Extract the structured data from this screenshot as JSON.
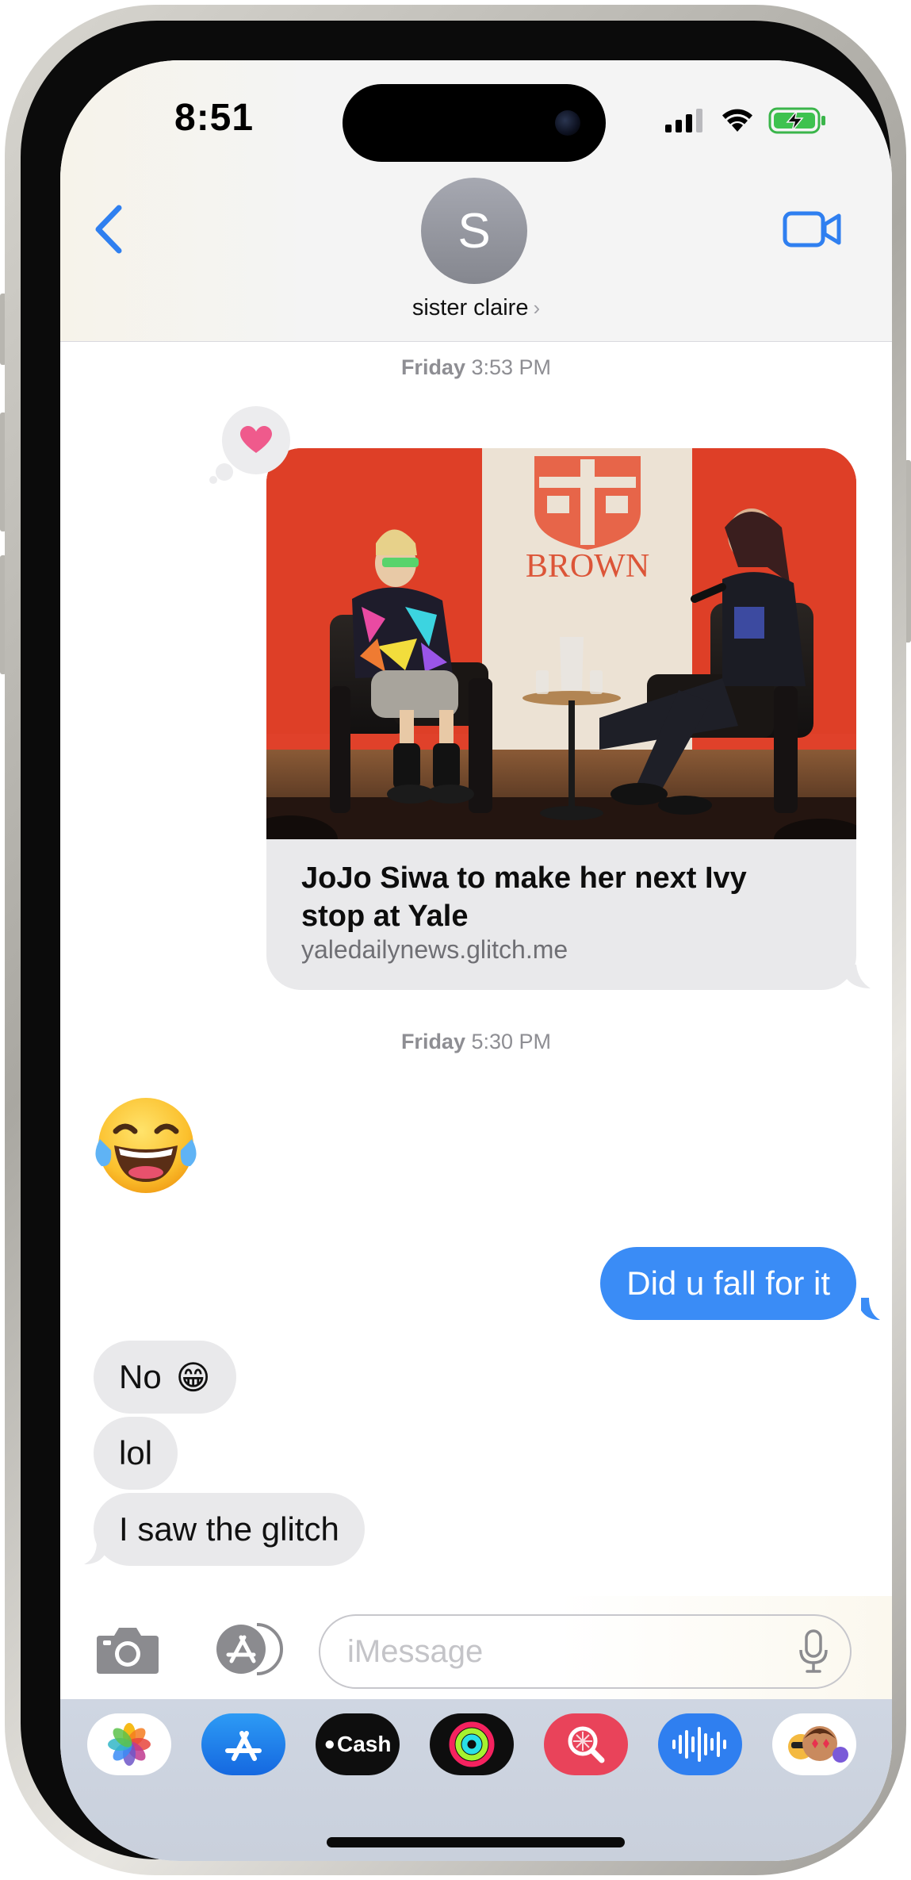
{
  "status_bar": {
    "time": "8:51",
    "icons": [
      "cellular-signal-icon",
      "wifi-icon",
      "battery-charging-icon"
    ]
  },
  "header": {
    "avatar_initial": "S",
    "contact_name": "sister claire",
    "chevron": "›",
    "back_icon": "back-chevron-icon",
    "video_icon": "video-camera-icon"
  },
  "conversation": {
    "timestamps": [
      {
        "day": "Friday",
        "time": "3:53 PM"
      },
      {
        "day": "Friday",
        "time": "5:30 PM"
      }
    ],
    "link_preview": {
      "banner_text": "BROWN",
      "title": "JoJo Siwa to make her next Ivy stop at Yale",
      "url": "yaledailynews.glitch.me",
      "tapback": "heart-icon",
      "colors": {
        "backdrop": "#e0412a",
        "banner": "#ece2d4",
        "tapback_heart": "#ef5a8c"
      }
    },
    "received_emoji": "😂",
    "outgoing": [
      {
        "text": "Did u fall for it"
      }
    ],
    "incoming": [
      {
        "text": "No",
        "emoji": "😁"
      },
      {
        "text": "lol"
      },
      {
        "text": "I saw the glitch"
      }
    ]
  },
  "compose": {
    "placeholder": "iMessage",
    "value": "",
    "camera_icon": "camera-icon",
    "apps_icon": "app-store-icon",
    "mic_icon": "microphone-icon"
  },
  "app_drawer": {
    "apps": [
      {
        "name": "photos-icon"
      },
      {
        "name": "app-store-icon"
      },
      {
        "name": "apple-cash-icon",
        "label": "Cash"
      },
      {
        "name": "activity-icon"
      },
      {
        "name": "images-search-icon"
      },
      {
        "name": "audio-message-icon"
      },
      {
        "name": "memoji-icon"
      }
    ]
  },
  "colors": {
    "accent": "#2f7ff0",
    "outgoing_bubble": "#3a8cf6",
    "incoming_bubble": "#e9e9eb"
  }
}
